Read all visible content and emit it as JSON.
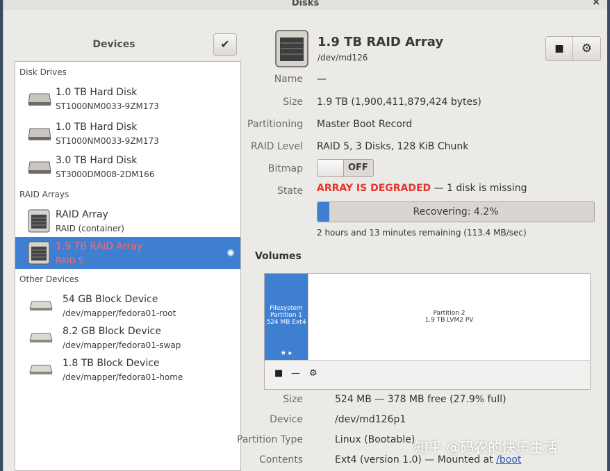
{
  "window": {
    "title": "Disks",
    "close": "×"
  },
  "sidebar": {
    "title": "Devices",
    "select_icon": "✔",
    "groups": [
      {
        "label": "Disk Drives"
      },
      {
        "label": "RAID Arrays"
      },
      {
        "label": "Other Devices"
      }
    ],
    "items": [
      {
        "name": "1.0 TB Hard Disk",
        "sub": "ST1000NM0033-9ZM173",
        "icon": "hard-disk-icon"
      },
      {
        "name": "1.0 TB Hard Disk",
        "sub": "ST1000NM0033-9ZM173",
        "icon": "hard-disk-icon"
      },
      {
        "name": "3.0 TB Hard Disk",
        "sub": "ST3000DM008-2DM166",
        "icon": "hard-disk-icon"
      },
      {
        "name": "RAID Array",
        "sub": "RAID (container)",
        "icon": "raid-icon"
      },
      {
        "name": "1.9 TB RAID Array",
        "sub": "RAID 5",
        "icon": "raid-icon",
        "selected": true
      },
      {
        "name": "54 GB Block Device",
        "sub": "/dev/mapper/fedora01-root",
        "icon": "block-device-icon"
      },
      {
        "name": "8.2 GB Block Device",
        "sub": "/dev/mapper/fedora01-swap",
        "icon": "block-device-icon"
      },
      {
        "name": "1.8 TB Block Device",
        "sub": "/dev/mapper/fedora01-home",
        "icon": "block-device-icon"
      }
    ]
  },
  "main": {
    "title": "1.9 TB RAID Array",
    "subtitle": "/dev/md126",
    "stop_icon": "■",
    "gear_icon": "⚙",
    "props": {
      "name_label": "Name",
      "name_value": "—",
      "size_label": "Size",
      "size_value": "1.9 TB (1,900,411,879,424 bytes)",
      "partitioning_label": "Partitioning",
      "partitioning_value": "Master Boot Record",
      "raid_label": "RAID Level",
      "raid_value": "RAID 5, 3 Disks, 128 KiB Chunk",
      "bitmap_label": "Bitmap",
      "bitmap_value": "OFF",
      "state_label": "State",
      "state_degraded": "ARRAY IS DEGRADED",
      "state_rest": " — 1 disk is missing"
    },
    "progress": {
      "text": "Recovering: 4.2%",
      "fraction": 0.042
    },
    "remaining": "2 hours and 13 minutes remaining (113.4 MB/sec)",
    "volumes": {
      "heading": "Volumes",
      "part1": {
        "line1": "Filesystem",
        "line2": "Partition 1",
        "line3": "524 MB Ext4",
        "icons": "★ ▸"
      },
      "part2": {
        "line1": "Partition 2",
        "line2": "1.9 TB LVM2 PV"
      },
      "tools": {
        "stop": "■",
        "minus": "—",
        "gears": "⚙"
      }
    },
    "volprops": {
      "size_label": "Size",
      "size_value": "524 MB — 378 MB free (27.9% full)",
      "device_label": "Device",
      "device_value": "/dev/md126p1",
      "ptype_label": "Partition Type",
      "ptype_value": "Linux (Bootable)",
      "contents_label": "Contents",
      "contents_value": "Ext4 (version 1.0) — Mounted at ",
      "contents_link": "/boot"
    }
  },
  "watermark": "知乎 @码农的快乐生活"
}
